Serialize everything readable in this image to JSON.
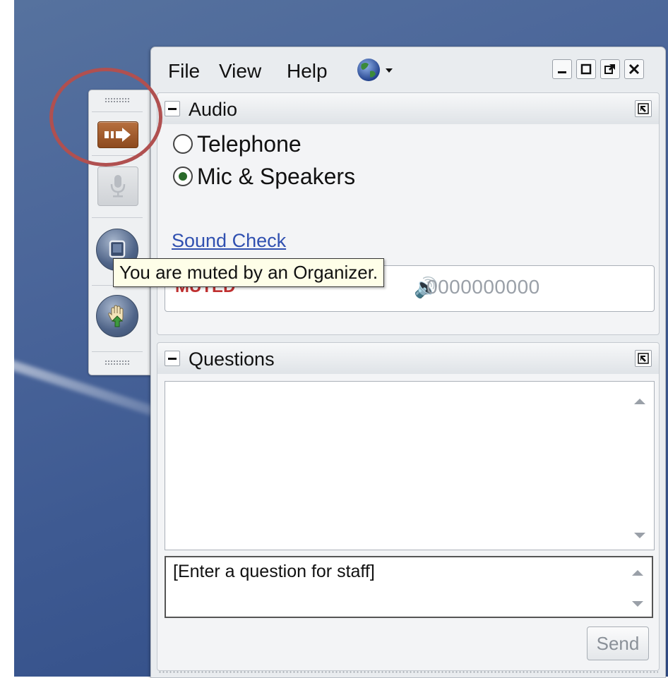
{
  "menubar": {
    "items": [
      "File",
      "View",
      "Help"
    ],
    "globe_icon": "globe-icon",
    "window_controls": [
      "minimize-icon",
      "maximize-icon",
      "popout-icon",
      "close-icon"
    ]
  },
  "audio": {
    "title": "Audio",
    "options": [
      {
        "label": "Telephone",
        "selected": false
      },
      {
        "label": "Mic & Speakers",
        "selected": true
      }
    ],
    "sound_check_link": "Sound Check",
    "status_label": "MUTED",
    "level_readout": "0000000000"
  },
  "tooltip": {
    "text": "You are muted by an Organizer."
  },
  "questions": {
    "title": "Questions",
    "input_placeholder": "[Enter a question for staff]",
    "send_label": "Send"
  },
  "grab_tab": {
    "buttons": [
      "show-hide-arrow-icon",
      "microphone-icon",
      "screen-icon",
      "raise-hand-icon"
    ]
  },
  "colors": {
    "desktop": "#4b669a",
    "highlight_ring": "#b05050",
    "link": "#3050b0",
    "muted": "#c03030"
  }
}
